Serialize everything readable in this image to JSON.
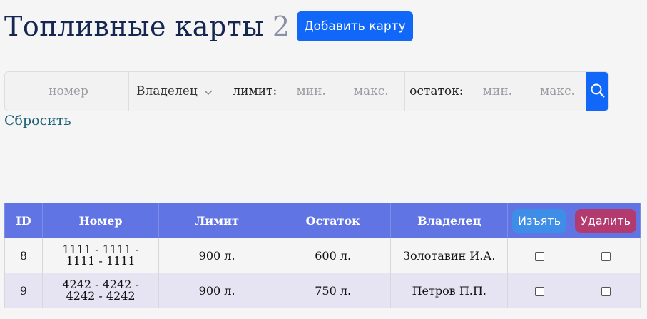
{
  "header": {
    "title": "Топливные карты",
    "count": "2",
    "add_button": "Добавить карту"
  },
  "filters": {
    "number_placeholder": "номер",
    "owner_select": "Владелец",
    "limit_label": "лимит:",
    "limit_min_placeholder": "мин.",
    "limit_max_placeholder": "макс.",
    "rest_label": "остаток:",
    "rest_min_placeholder": "мин.",
    "rest_max_placeholder": "макс.",
    "reset_link": "Сбросить"
  },
  "table": {
    "headers": {
      "id": "ID",
      "number": "Номер",
      "limit": "Лимит",
      "rest": "Остаток",
      "owner": "Владелец",
      "withdraw_button": "Изъять",
      "delete_button": "Удалить"
    },
    "rows": [
      {
        "id": "8",
        "number_line1": "1111 - 1111 -",
        "number_line2": "1111 - 1111",
        "limit": "900 л.",
        "rest": "600 л.",
        "owner": "Золотавин И.А."
      },
      {
        "id": "9",
        "number_line1": "4242 - 4242 -",
        "number_line2": "4242 - 4242",
        "limit": "900 л.",
        "rest": "750 л.",
        "owner": "Петров П.П."
      }
    ]
  }
}
